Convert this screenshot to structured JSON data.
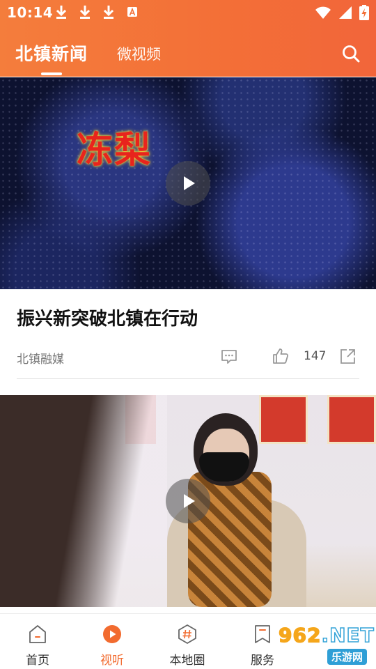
{
  "status_bar": {
    "time": "10:14",
    "icons": [
      "download-icon",
      "download-icon",
      "download-icon",
      "a-notification-icon",
      "wifi-icon",
      "signal-icon",
      "battery-charging-icon"
    ]
  },
  "top_nav": {
    "tabs": [
      {
        "label": "北镇新闻",
        "active": true
      },
      {
        "label": "微视频",
        "active": false
      }
    ],
    "search_icon": "search-icon"
  },
  "feed": [
    {
      "thumbnail_text": "冻梨",
      "title": "振兴新突破北镇在行动",
      "source": "北镇融媒",
      "likes": "147",
      "icons": [
        "comment-icon",
        "like-icon",
        "share-icon"
      ]
    },
    {
      "thumbnail_text": "",
      "title": "",
      "source": ""
    }
  ],
  "bottom_nav": {
    "items": [
      {
        "label": "首页",
        "icon": "home-icon",
        "active": false
      },
      {
        "label": "视听",
        "icon": "play-circle-icon",
        "active": true
      },
      {
        "label": "本地圈",
        "icon": "hashtag-icon",
        "active": false
      },
      {
        "label": "服务",
        "icon": "bookmark-icon",
        "active": false
      }
    ]
  },
  "watermark": {
    "logo": "962.NET",
    "sub": "乐游网"
  },
  "colors": {
    "accent": "#f26b2f",
    "header_gradient_start": "#f47d3c",
    "header_gradient_end": "#f2653a"
  }
}
